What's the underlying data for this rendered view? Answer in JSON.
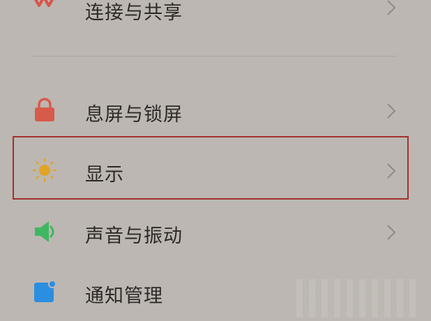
{
  "settings": {
    "items": [
      {
        "label": "连接与共享",
        "icon": "connection-icon",
        "color": "#d9534a"
      },
      {
        "label": "息屏与锁屏",
        "icon": "lock-icon",
        "color": "#d75b4b"
      },
      {
        "label": "显示",
        "icon": "sun-icon",
        "color": "#e0a524"
      },
      {
        "label": "声音与振动",
        "icon": "speaker-icon",
        "color": "#3fb760"
      },
      {
        "label": "通知管理",
        "icon": "notification-icon",
        "color": "#2b8ee0"
      }
    ]
  },
  "highlight": {
    "color": "#a2302d"
  }
}
